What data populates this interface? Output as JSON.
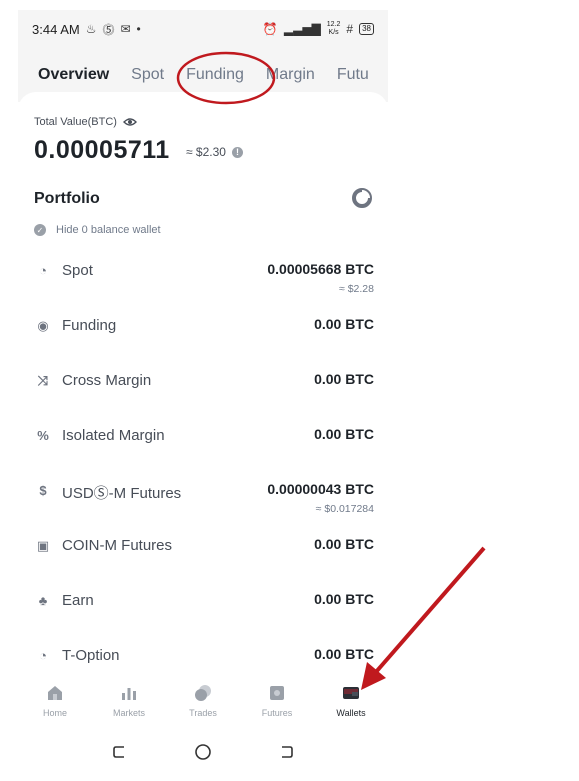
{
  "status_bar": {
    "time": "3:44 AM",
    "speed": "12.2",
    "speed_unit": "K/s",
    "battery": "38"
  },
  "tabs": [
    {
      "label": "Overview",
      "active": true
    },
    {
      "label": "Spot",
      "active": false
    },
    {
      "label": "Funding",
      "active": false
    },
    {
      "label": "Margin",
      "active": false
    },
    {
      "label": "Futu",
      "active": false
    }
  ],
  "total": {
    "label": "Total Value(BTC)",
    "value": "0.00005711",
    "approx": "≈ $2.30"
  },
  "portfolio": {
    "title": "Portfolio",
    "hide_zero_label": "Hide 0 balance wallet"
  },
  "wallets": [
    {
      "name": "Spot",
      "amount": "0.00005668 BTC",
      "usd": "≈ $2.28",
      "icon": "spot-icon"
    },
    {
      "name": "Funding",
      "amount": "0.00 BTC",
      "usd": "",
      "icon": "funding-icon"
    },
    {
      "name": "Cross Margin",
      "amount": "0.00 BTC",
      "usd": "",
      "icon": "cross-margin-icon"
    },
    {
      "name": "Isolated Margin",
      "amount": "0.00 BTC",
      "usd": "",
      "icon": "isolated-margin-icon"
    },
    {
      "name": "USDⓈ-M Futures",
      "amount": "0.00000043 BTC",
      "usd": "≈ $0.017284",
      "icon": "usdm-futures-icon"
    },
    {
      "name": "COIN-M Futures",
      "amount": "0.00 BTC",
      "usd": "",
      "icon": "coinm-futures-icon"
    },
    {
      "name": "Earn",
      "amount": "0.00 BTC",
      "usd": "",
      "icon": "earn-icon"
    },
    {
      "name": "T-Option",
      "amount": "0.00 BTC",
      "usd": "",
      "icon": "t-option-icon"
    }
  ],
  "bottom_nav": [
    {
      "label": "Home",
      "icon": "home-icon",
      "active": false
    },
    {
      "label": "Markets",
      "icon": "markets-icon",
      "active": false
    },
    {
      "label": "Trades",
      "icon": "trades-icon",
      "active": false
    },
    {
      "label": "Futures",
      "icon": "futures-icon",
      "active": false
    },
    {
      "label": "Wallets",
      "icon": "wallets-icon",
      "active": true
    }
  ],
  "colors": {
    "annotation_red": "#c0191e",
    "text_primary": "#1e2329",
    "text_secondary": "#707a8a"
  }
}
